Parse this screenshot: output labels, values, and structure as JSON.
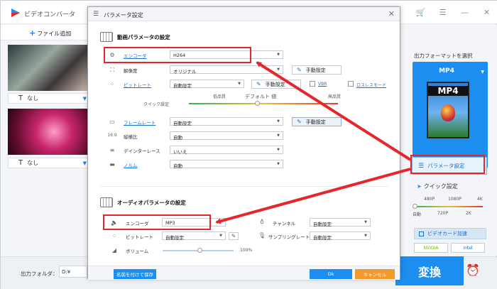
{
  "app": {
    "title": "ビデオコンバータ",
    "add_file": "ファイル追加",
    "subtitle_1": "なし",
    "subtitle_2": "なし",
    "output_folder_label": "出力フォルダ：",
    "output_folder_path": "D:¥",
    "convert": "変換",
    "icons": [
      "logo-icon",
      "cart-icon",
      "menu-icon",
      "minimize-icon",
      "close-icon",
      "alarm-clock-icon"
    ]
  },
  "right_panel": {
    "output_format_label": "出力フォーマットを選択",
    "format_name": "MP4",
    "format_icon_label": "MP4",
    "param_button": "パラメータ設定",
    "quick_setting": "クイック設定",
    "quick_top": [
      "480P",
      "1080P",
      "4K"
    ],
    "quick_bottom": [
      "自動",
      "720P",
      "2K"
    ],
    "gpu_accel": "ビデオカード加速",
    "vendors": [
      "NVIDIA",
      "intel"
    ]
  },
  "dialog": {
    "title": "パラメータ設定",
    "video_section": "動画パラメータの設定",
    "audio_section": "オーディオパラメータの設定",
    "video": {
      "encoder_label": "エンコーダ",
      "encoder_value": "H264",
      "resolution_label": "解像度",
      "resolution_value": "オリジナル",
      "manual_1": "手動設定",
      "bitrate_label": "ビットレート",
      "bitrate_value": "自動設定",
      "manual_2": "手動設定",
      "vbr_label": "VBR",
      "lossless_label": "ロスレスモード",
      "quick_setting_label": "クイック設定",
      "low_quality": "低品質",
      "default_value": "デフォルト 値",
      "high_quality": "高品質",
      "framerate_label": "フレームレート",
      "framerate_value": "自動設定",
      "manual_3": "手動設定",
      "aspect_label": "縦横比",
      "aspect_value": "自動",
      "deinterlace_label": "デインターレース",
      "deinterlace_value": "いいえ",
      "normal_label": "ノルム",
      "normal_value": "自動"
    },
    "audio": {
      "encoder_label": "エンコーダ",
      "encoder_value": "MP3",
      "channel_label": "チャンネル",
      "channel_value": "自動設定",
      "bitrate_label": "ビットレート",
      "bitrate_value": "自動設定",
      "sample_label": "サンプリングレート",
      "sample_value": "自動設定",
      "volume_label": "ボリューム",
      "volume_value": "100%"
    },
    "footer": {
      "save_name": "名前を付けて保存",
      "ok": "Ok",
      "cancel": "キャンセル"
    }
  },
  "colors": {
    "accent": "#1c8ef0",
    "highlight": "#e5262b",
    "cancel": "#f29a2e"
  }
}
